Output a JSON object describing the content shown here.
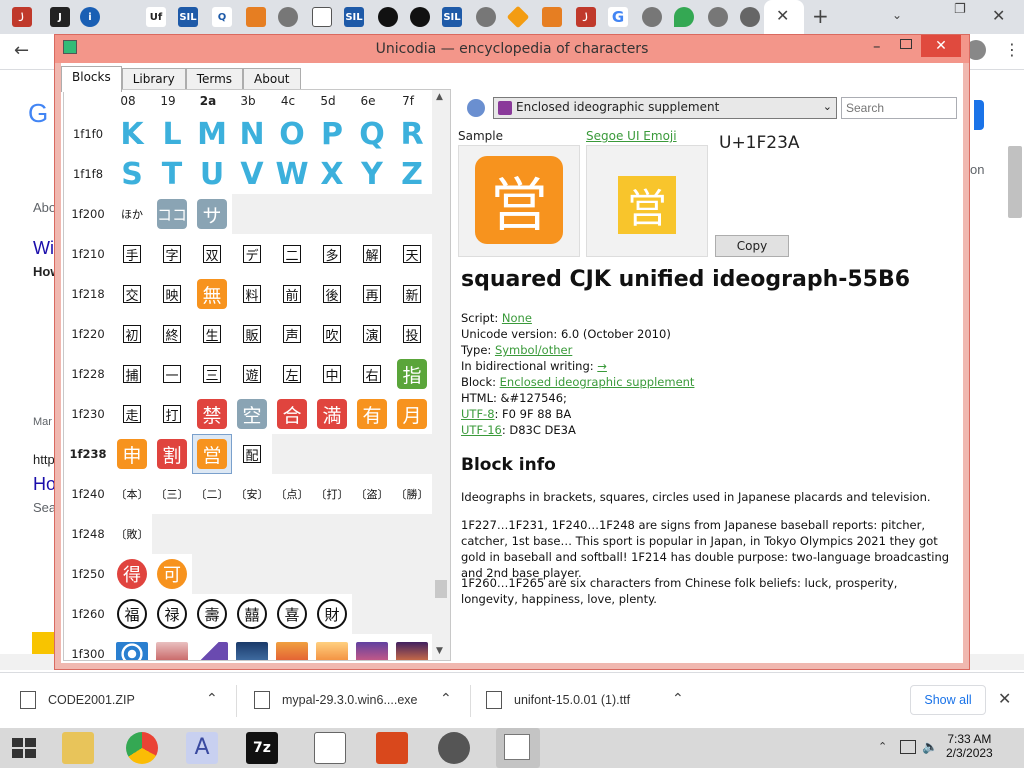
{
  "window": {
    "title": "Unicodia — encyclopedia of characters",
    "tabs": [
      "Blocks",
      "Library",
      "Terms",
      "About"
    ]
  },
  "grid": {
    "columns": [
      "08",
      "19",
      "2a",
      "3b",
      "4c",
      "5d",
      "6e",
      "7f"
    ],
    "rows": [
      "1f1f0",
      "1f1f8",
      "1f200",
      "1f210",
      "1f218",
      "1f220",
      "1f228",
      "1f230",
      "1f238",
      "1f240",
      "1f248",
      "1f250",
      "1f260",
      "1f300"
    ],
    "letters_row1": [
      "K",
      "L",
      "M",
      "N",
      "O",
      "P",
      "Q",
      "R"
    ],
    "letters_row2": [
      "S",
      "T",
      "U",
      "V",
      "W",
      "X",
      "Y",
      "Z"
    ],
    "row_1f200": [
      "ほか",
      "ココ",
      "サ"
    ],
    "row_1f210": [
      "手",
      "字",
      "双",
      "デ",
      "二",
      "多",
      "解",
      "天"
    ],
    "row_1f218": [
      "交",
      "映",
      "無",
      "料",
      "前",
      "後",
      "再",
      "新"
    ],
    "row_1f220": [
      "初",
      "終",
      "生",
      "販",
      "声",
      "吹",
      "演",
      "投"
    ],
    "row_1f228": [
      "捕",
      "一",
      "三",
      "遊",
      "左",
      "中",
      "右",
      "指"
    ],
    "row_1f230": [
      "走",
      "打",
      "禁",
      "空",
      "合",
      "満",
      "有",
      "月"
    ],
    "row_1f238": [
      "申",
      "割",
      "営",
      "配"
    ],
    "row_1f240": [
      "〔本〕",
      "〔三〕",
      "〔二〕",
      "〔安〕",
      "〔点〕",
      "〔打〕",
      "〔盗〕",
      "〔勝〕"
    ],
    "row_1f248": [
      "〔敗〕"
    ],
    "row_1f250": [
      "得",
      "可"
    ],
    "row_1f260": [
      "福",
      "禄",
      "壽",
      "囍",
      "喜",
      "財"
    ]
  },
  "detail": {
    "block_combo": "Enclosed ideographic supplement",
    "search_placeholder": "Search",
    "sample_label": "Sample",
    "font_label": "Segoe UI Emoji",
    "codepoint": "U+1F23A",
    "glyph": "営",
    "copy_label": "Copy",
    "char_name": "squared CJK unified ideograph-55B6",
    "script_label": "Script:",
    "script_value": "None",
    "version_line": "Unicode version: 6.0 (October 2010)",
    "type_label": "Type:",
    "type_value": "Symbol/other",
    "bidi_label": "In bidirectional writing:",
    "bidi_value": "→",
    "block_label": "Block:",
    "block_value": "Enclosed ideographic supplement",
    "html_line": "HTML: &#127546;",
    "utf8_label": "UTF-8",
    "utf8_value": ": F0 9F 88 BA",
    "utf16_label": "UTF-16",
    "utf16_value": ": D83C DE3A",
    "block_info_heading": "Block info",
    "para1": "Ideographs in brackets, squares, circles used in Japanese placards and television.",
    "para2": "1F227…1F231, 1F240…1F248 are signs from Japanese baseball reports: pitcher, catcher, 1st base… This sport is popular in Japan, in Tokyo Olympics 2021 they got gold in baseball and softball! 1F214 has double purpose: two-language broadcasting and 2nd base player.",
    "para3": "1F260…1F265 are six characters from Chinese folk beliefs: luck, prosperity, longevity, happiness, love, plenty."
  },
  "downloads": {
    "items": [
      "CODE2001.ZIP",
      "mypal-29.3.0.win6....exe",
      "unifont-15.0.01 (1).ttf"
    ],
    "show_all": "Show all"
  },
  "taskbar": {
    "time": "7:33 AM",
    "date": "2/3/2023"
  },
  "background_page": {
    "snippets": [
      "G",
      "Abo",
      "Wi",
      "How",
      "Mar",
      "http",
      "Ho",
      "Sea",
      "on"
    ]
  },
  "colors": {
    "title_bar": "#f3968a",
    "letter_blue": "#3cb0dc",
    "orange": "#f7931e",
    "red": "#e0443e",
    "link_green": "#3a9a3a"
  }
}
